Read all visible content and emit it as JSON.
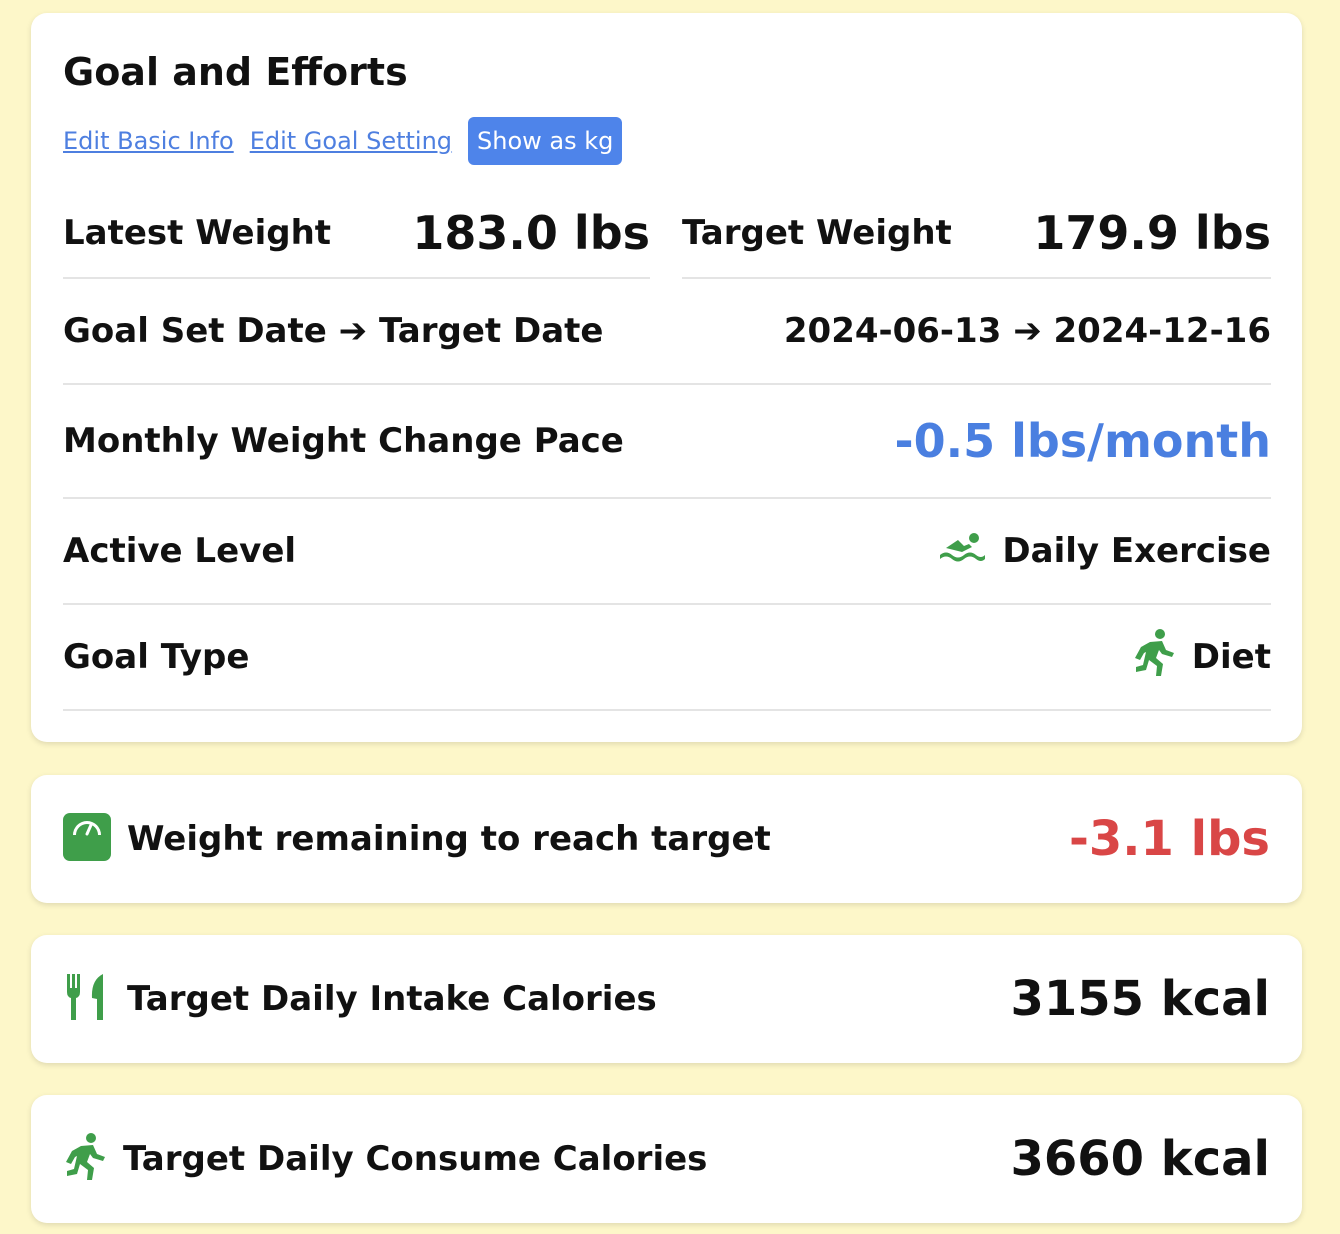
{
  "title": "Goal and Efforts",
  "actions": {
    "edit_basic_info": "Edit Basic Info",
    "edit_goal_setting": "Edit Goal Setting",
    "show_as_kg": "Show as kg"
  },
  "latest_weight": {
    "label": "Latest Weight",
    "value": "183.0 lbs"
  },
  "target_weight": {
    "label": "Target Weight",
    "value": "179.9 lbs"
  },
  "dates": {
    "label": "Goal Set Date ➔ Target Date",
    "value": "2024-06-13 ➔ 2024-12-16"
  },
  "pace": {
    "label": "Monthly Weight Change Pace",
    "value": "-0.5 lbs/month",
    "color": "#4a7fe0"
  },
  "active_level": {
    "label": "Active Level",
    "value": "Daily Exercise",
    "icon": "swimmer-icon"
  },
  "goal_type": {
    "label": "Goal Type",
    "value": "Diet",
    "icon": "running-person-icon"
  },
  "remaining": {
    "label": "Weight remaining to reach target",
    "value": "-3.1 lbs",
    "color": "#d94646",
    "icon": "weight-scale-icon"
  },
  "intake": {
    "label": "Target Daily Intake Calories",
    "value": "3155 kcal",
    "icon": "utensils-icon"
  },
  "consume": {
    "label": "Target Daily Consume Calories",
    "value": "3660 kcal",
    "icon": "running-person-icon"
  },
  "colors": {
    "icon_green": "#3f9e4a",
    "background": "#fdf7c9",
    "link": "#4e7fe0",
    "button": "#4e84ea"
  }
}
